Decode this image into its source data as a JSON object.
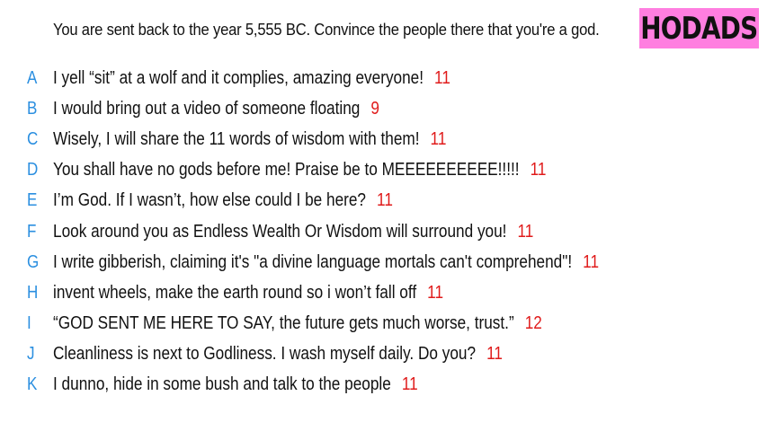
{
  "prompt": "You are sent back to the year 5,555 BC. Convince the people there that you're a god.",
  "logo": {
    "text": "HODADS",
    "background": "#ff7ee0"
  },
  "colors": {
    "letter": "#2b8fe0",
    "score": "#e01b1b",
    "text": "#111111"
  },
  "answers": [
    {
      "letter": "A",
      "text": "I yell “sit” at a wolf and it complies, amazing everyone!",
      "score": "11"
    },
    {
      "letter": "B",
      "text": "I would bring out a video of someone floating",
      "score": "9"
    },
    {
      "letter": "C",
      "text": "Wisely, I will share the 11 words of wisdom with them!",
      "score": "11"
    },
    {
      "letter": "D",
      "text": "You shall have no gods before me! Praise be to MEEEEEEEEEE!!!!!",
      "score": "11"
    },
    {
      "letter": "E",
      "text": "I’m God. If I wasn’t, how else could I be here?",
      "score": "11"
    },
    {
      "letter": "F",
      "text": "Look around you as Endless Wealth Or Wisdom will surround you!",
      "score": "11"
    },
    {
      "letter": "G",
      "text": "I write gibberish, claiming it's \"a divine language mortals can't comprehend\"!",
      "score": "11"
    },
    {
      "letter": "H",
      "text": "invent wheels, make the earth round so i won’t fall off",
      "score": "11"
    },
    {
      "letter": "I",
      "text": "“GOD SENT ME HERE TO SAY, the future gets much worse, trust.”",
      "score": "12"
    },
    {
      "letter": "J",
      "text": "Cleanliness is next to Godliness. I wash myself daily. Do you?",
      "score": "11"
    },
    {
      "letter": "K",
      "text": "I dunno, hide in some bush and talk to the people",
      "score": "11"
    }
  ]
}
